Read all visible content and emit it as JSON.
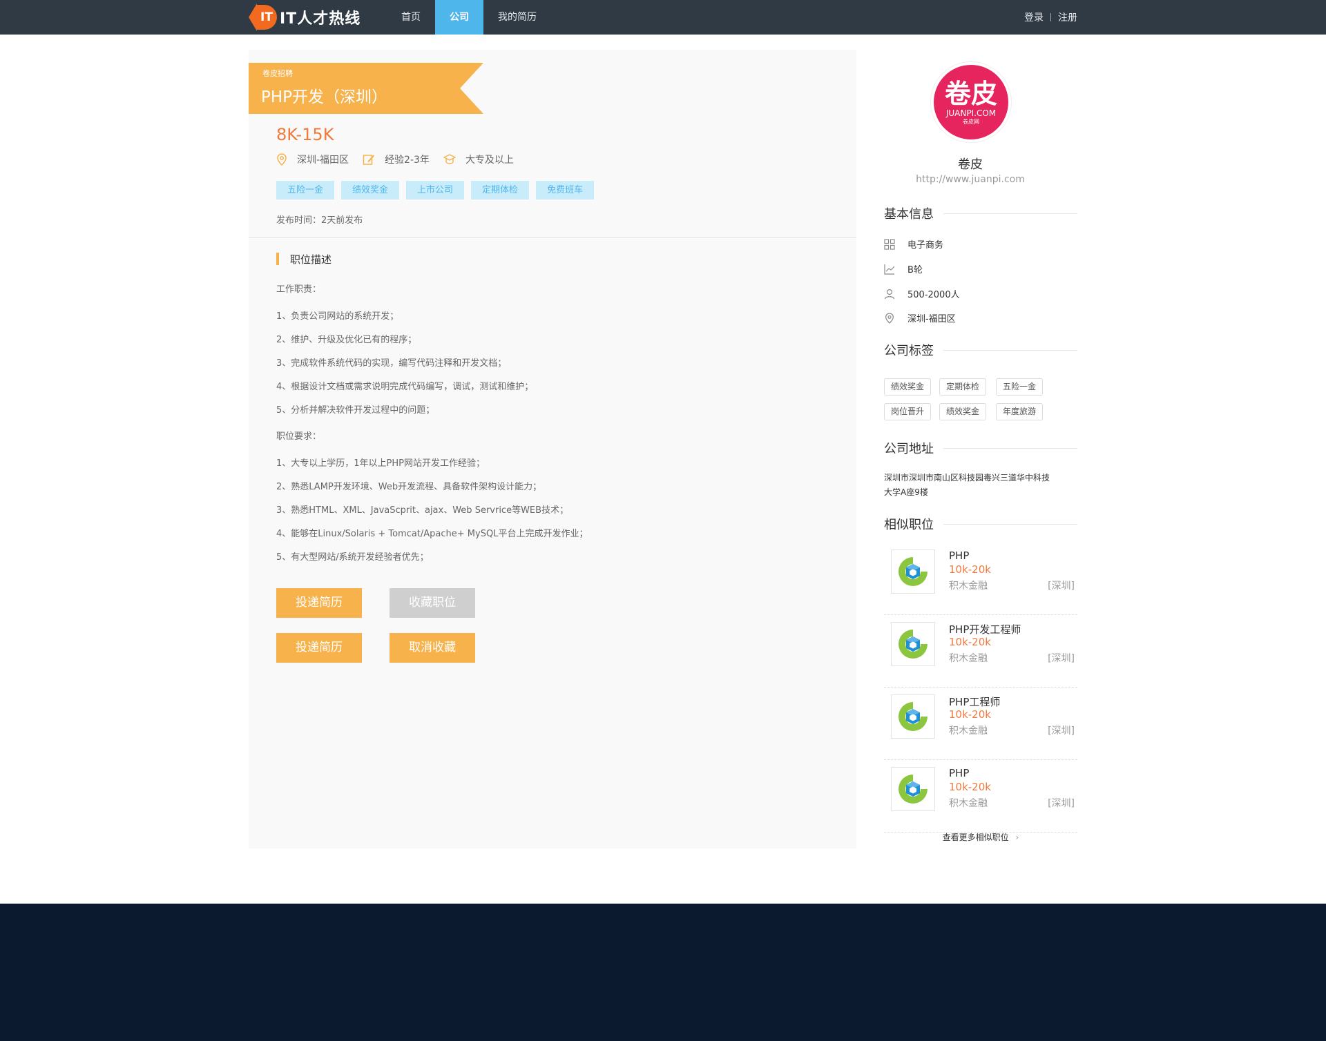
{
  "header": {
    "logo_badge": "IT",
    "logo_text": "IT人才热线",
    "nav": [
      "首页",
      "公司",
      "我的简历"
    ],
    "active_nav": "公司",
    "login": "登录",
    "register": "注册"
  },
  "job": {
    "company_tag": "卷皮招聘",
    "title": "PHP开发（深圳）",
    "salary": "8K-15K",
    "location": "深圳-福田区",
    "experience": "经验2-3年",
    "education": "大专及以上",
    "tags": [
      "五险一金",
      "绩效奖金",
      "上市公司",
      "定期体检",
      "免费班车"
    ],
    "publish_time": "发布时间：2天前发布",
    "section_title": "职位描述",
    "duties_heading": "工作职责：",
    "duties": [
      "1、负责公司网站的系统开发；",
      "2、维护、升级及优化已有的程序；",
      "3、完成软件系统代码的实现，编写代码注释和开发文档；",
      "4、根据设计文档或需求说明完成代码编写，调试，测试和维护；",
      "5、分析并解决软件开发过程中的问题；"
    ],
    "req_heading": "职位要求：",
    "requirements": [
      "1、大专以上学历，1年以上PHP网站开发工作经验；",
      "2、熟悉LAMP开发环境、Web开发流程、具备软件架构设计能力；",
      "3、熟悉HTML、XML、JavaScprit、ajax、Web Servrice等WEB技术；",
      "4、能够在Linux/Solaris + Tomcat/Apache+ MySQL平台上完成开发作业；",
      "5、有大型网站/系统开发经验者优先；"
    ],
    "buttons": {
      "apply_1": "投递简历",
      "favorite": "收藏职位",
      "apply_2": "投递简历",
      "unfavorite": "取消收藏"
    }
  },
  "company": {
    "logo_big": "卷皮",
    "logo_domain": "JUANPI.COM",
    "logo_small": "卷皮网",
    "name": "卷皮",
    "url": "http://www.juanpi.com",
    "basic_title": "基本信息",
    "industry": "电子商务",
    "stage": "B轮",
    "size": "500-2000人",
    "location": "深圳-福田区",
    "tags_title": "公司标签",
    "tags": [
      "绩效奖金",
      "定期体检",
      "五险一金",
      "岗位晋升",
      "绩效奖金",
      "年度旅游"
    ],
    "address_title": "公司地址",
    "address_line1": "深圳市深圳市南山区科技园毒兴三道华中科技",
    "address_line2": "大学A座9楼"
  },
  "similar": {
    "title": "相似职位",
    "jobs": [
      {
        "title": "PHP",
        "salary": "10k-20k",
        "company": "积木金融",
        "city": "[深圳]"
      },
      {
        "title": "PHP开发工程师",
        "salary": "10k-20k",
        "company": "积木金融",
        "city": "[深圳]"
      },
      {
        "title": "PHP工程师",
        "salary": "10k-20k",
        "company": "积木金融",
        "city": "[深圳]"
      },
      {
        "title": "PHP",
        "salary": "10k-20k",
        "company": "积木金融",
        "city": "[深圳]"
      }
    ],
    "more": "查看更多相似职位"
  },
  "colors": {
    "topbar": "#2f3a44",
    "nav_active": "#4fb6ec",
    "accent_orange": "#f7b24b",
    "salary": "#f07a3d",
    "footer": "#0b1a2e"
  }
}
